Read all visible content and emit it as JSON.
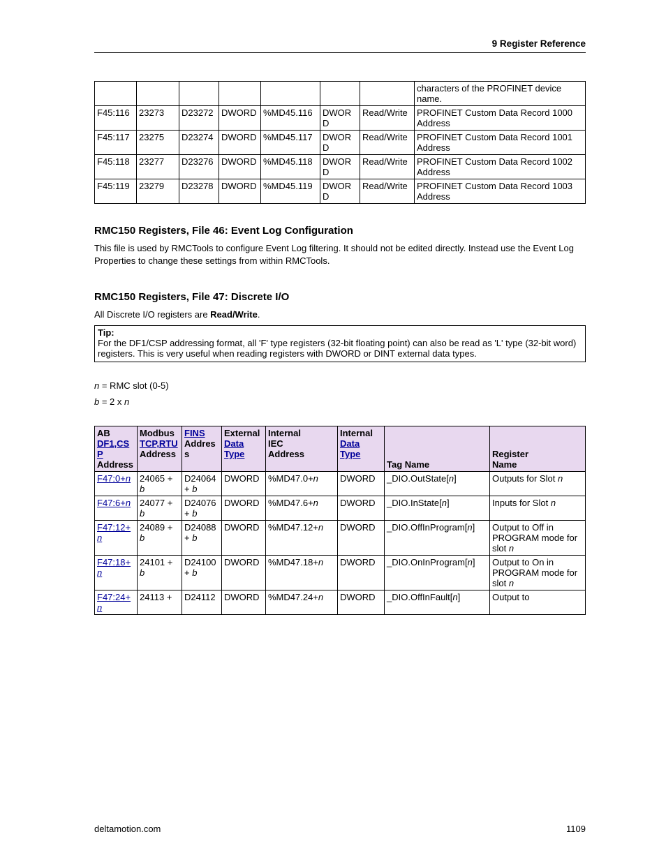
{
  "header": "9  Register Reference",
  "footer_left": "deltamotion.com",
  "footer_right": "1109",
  "table1": {
    "top_partial_desc_html": "characters of the PROFINET device name.",
    "rows": [
      {
        "ab": "F45:116",
        "modbus": "23273",
        "fins": "D23272",
        "ext": "DWORD",
        "iec": "%MD45.116",
        "int": "DWORD",
        "acc": "Read/Write",
        "desc": "PROFINET Custom Data Record 1000 Address"
      },
      {
        "ab": "F45:117",
        "modbus": "23275",
        "fins": "D23274",
        "ext": "DWORD",
        "iec": "%MD45.117",
        "int": "DWORD",
        "acc": "Read/Write",
        "desc": "PROFINET Custom Data Record 1001 Address"
      },
      {
        "ab": "F45:118",
        "modbus": "23277",
        "fins": "D23276",
        "ext": "DWORD",
        "iec": "%MD45.118",
        "int": "DWORD",
        "acc": "Read/Write",
        "desc": "PROFINET Custom Data Record 1002 Address"
      },
      {
        "ab": "F45:119",
        "modbus": "23279",
        "fins": "D23278",
        "ext": "DWORD",
        "iec": "%MD45.119",
        "int": "DWORD",
        "acc": "Read/Write",
        "desc": "PROFINET Custom Data Record 1003 Address"
      }
    ]
  },
  "section1": {
    "heading": "RMC150 Registers, File 46: Event Log Configuration",
    "para": "This file is used by RMCTools to configure Event Log filtering. It should not be edited directly. Instead use the Event Log Properties to change these settings from within RMCTools."
  },
  "section2": {
    "heading": "RMC150 Registers, File 47:  Discrete I/O",
    "intro_pre": "All Discrete I/O registers are ",
    "intro_bold": "Read/Write",
    "intro_post": ".",
    "tip_label": "Tip:",
    "tip_body": "For the DF1/CSP addressing format, all 'F' type registers (32-bit floating point) can also be read as 'L' type (32-bit word) registers. This is very useful when reading registers with DWORD or DINT external data types.",
    "note1_html": "<span class='it'>n</span> = RMC slot (0-5)",
    "note2_html": "<span class='it'>b</span> = 2 x <span class='it'>n</span>"
  },
  "table2": {
    "head": {
      "ab_top": "AB",
      "ab_link": "DF1,CSP",
      "ab_bot": "Address",
      "mod_top": "Modbus",
      "mod_link": "TCP,RTU",
      "mod_bot": "Address",
      "fins_link": "FINS",
      "fins_bot": "Address",
      "ext_top": "External",
      "ext_link": "Data Type",
      "iec_top": "Internal",
      "iec_mid": "IEC",
      "iec_bot": "Address",
      "int_top": "Internal",
      "int_link": "Data Type",
      "tag": "Tag Name",
      "reg_top": "Register",
      "reg_bot": "Name"
    },
    "rows": [
      {
        "ab_html": "F47:0+<span class='it'>n</span>",
        "mod_html": "24065 + <span class='it'>b</span>",
        "fins_html": "D24064 + <span class='it'>b</span>",
        "ext": "DWORD",
        "iec_html": "%MD47.0+<span class='it'>n</span>",
        "int": "DWORD",
        "tag_html": "_DIO.OutState[<span class='it'>n</span>]",
        "reg_html": "Outputs for Slot <span class='it'>n</span>"
      },
      {
        "ab_html": "F47:6+<span class='it'>n</span>",
        "mod_html": "24077 + <span class='it'>b</span>",
        "fins_html": "D24076 + <span class='it'>b</span>",
        "ext": "DWORD",
        "iec_html": "%MD47.6+<span class='it'>n</span>",
        "int": "DWORD",
        "tag_html": "_DIO.InState[<span class='it'>n</span>]",
        "reg_html": "Inputs for Slot <span class='it'>n</span>"
      },
      {
        "ab_html": "F47:12+<span class='it'>n</span>",
        "mod_html": "24089 + <span class='it'>b</span>",
        "fins_html": "D24088 + <span class='it'>b</span>",
        "ext": "DWORD",
        "iec_html": "%MD47.12+<span class='it'>n</span>",
        "int": "DWORD",
        "tag_html": "_DIO.OffInProgram[<span class='it'>n</span>]",
        "reg_html": "Output to Off in PROGRAM mode for slot <span class='it'>n</span>"
      },
      {
        "ab_html": "F47:18+<span class='it'>n</span>",
        "mod_html": "24101 + <span class='it'>b</span>",
        "fins_html": "D24100 + <span class='it'>b</span>",
        "ext": "DWORD",
        "iec_html": "%MD47.18+<span class='it'>n</span>",
        "int": "DWORD",
        "tag_html": "_DIO.OnInProgram[<span class='it'>n</span>]",
        "reg_html": "Output to On in PROGRAM mode for slot <span class='it'>n</span>"
      },
      {
        "ab_html": "F47:24+<span class='it'>n</span>",
        "mod_html": "24113 + ",
        "fins_html": "D24112",
        "ext": "DWORD",
        "iec_html": "%MD47.24+<span class='it'>n</span>",
        "int": "DWORD",
        "tag_html": "_DIO.OffInFault[<span class='it'>n</span>]",
        "reg_html": "Output to"
      }
    ]
  }
}
